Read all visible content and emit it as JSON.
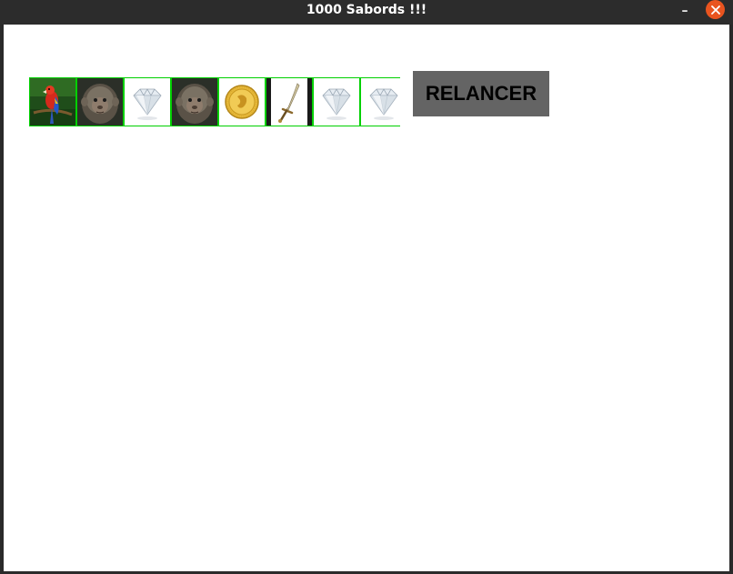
{
  "window": {
    "title": "1000 Sabords !!!",
    "minimize_icon": "minimize-icon",
    "close_icon": "close-icon"
  },
  "dice": [
    {
      "face": "parrot",
      "icon": "parrot-icon"
    },
    {
      "face": "monkey",
      "icon": "monkey-icon"
    },
    {
      "face": "diamond",
      "icon": "diamond-icon"
    },
    {
      "face": "monkey",
      "icon": "monkey-icon"
    },
    {
      "face": "gold-coin",
      "icon": "gold-coin-icon"
    },
    {
      "face": "sword",
      "icon": "sword-icon"
    },
    {
      "face": "diamond",
      "icon": "diamond-icon"
    },
    {
      "face": "diamond",
      "icon": "diamond-icon"
    }
  ],
  "actions": {
    "reroll_label": "RELANCER"
  },
  "colors": {
    "titlebar": "#2c2c2c",
    "close_button": "#e9541f",
    "die_border": "#00d000",
    "reroll_button": "#646464"
  }
}
